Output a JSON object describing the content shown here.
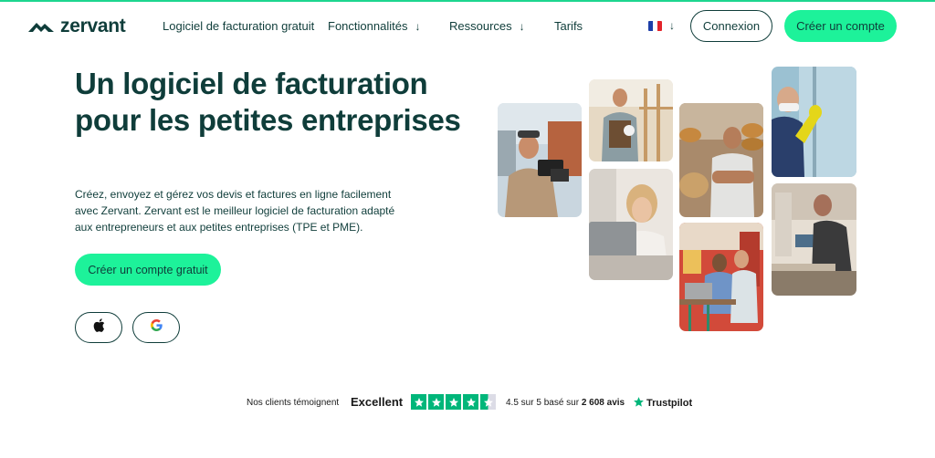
{
  "brand": {
    "name": "zervant",
    "accent": "#1df29a",
    "dark": "#0f3d3a"
  },
  "nav": {
    "items": [
      {
        "label": "Logiciel de facturation gratuit",
        "has_dropdown": false
      },
      {
        "label": "Fonctionnalités",
        "has_dropdown": true
      },
      {
        "label": "Ressources",
        "has_dropdown": true
      },
      {
        "label": "Tarifs",
        "has_dropdown": false
      }
    ],
    "dropdown_icon": "arrow-down-icon",
    "language_icon": "france-flag-icon",
    "login_label": "Connexion",
    "signup_label": "Créer un compte"
  },
  "hero": {
    "title": "Un logiciel de facturation pour les petites entreprises",
    "description": "Créez, envoyez et gérez vos devis et factures en ligne facilement avec Zervant. Zervant est le meilleur logiciel de facturation adapté aux entrepreneurs et aux petites entreprises (TPE et PME).",
    "cta_label": "Créer un compte gratuit",
    "store_buttons": [
      {
        "icon": "apple-icon"
      },
      {
        "icon": "google-icon"
      }
    ]
  },
  "photos": [
    {
      "subject": "videographer-with-camera"
    },
    {
      "subject": "construction-worker"
    },
    {
      "subject": "woman-at-laptop"
    },
    {
      "subject": "baker-with-bread"
    },
    {
      "subject": "people-at-laptop-in-cafe"
    },
    {
      "subject": "worker-with-mask-and-gloves"
    },
    {
      "subject": "man-repairing-electronics"
    }
  ],
  "trust": {
    "clients_label": "Nos clients témoignent",
    "rating_word": "Excellent",
    "stars": 4.5,
    "rating_prefix": "4.5 sur 5 basé sur",
    "review_count": "2 608 avis",
    "provider": "Trustpilot",
    "star_color": "#00b67a"
  }
}
